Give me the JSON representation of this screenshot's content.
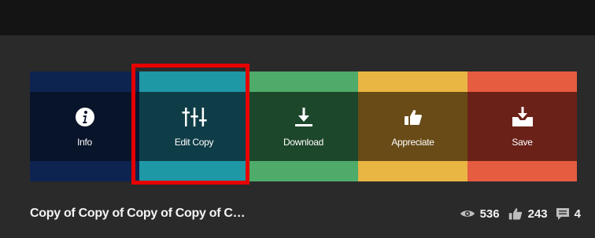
{
  "actions": [
    {
      "label": "Info",
      "icon": "info-icon"
    },
    {
      "label": "Edit Copy",
      "icon": "sliders-icon"
    },
    {
      "label": "Download",
      "icon": "download-icon"
    },
    {
      "label": "Appreciate",
      "icon": "thumbs-up-icon"
    },
    {
      "label": "Save",
      "icon": "save-tray-icon"
    }
  ],
  "project": {
    "title": "Copy of Copy of Copy of Copy of C…",
    "views": "536",
    "appreciations": "243",
    "comments": "4"
  },
  "colors": {
    "highlight": "#e60000",
    "info": "#0d2450",
    "edit_copy": "#1f98a6",
    "download": "#4eab6a",
    "appreciate": "#e9b543",
    "save": "#e55c40"
  }
}
